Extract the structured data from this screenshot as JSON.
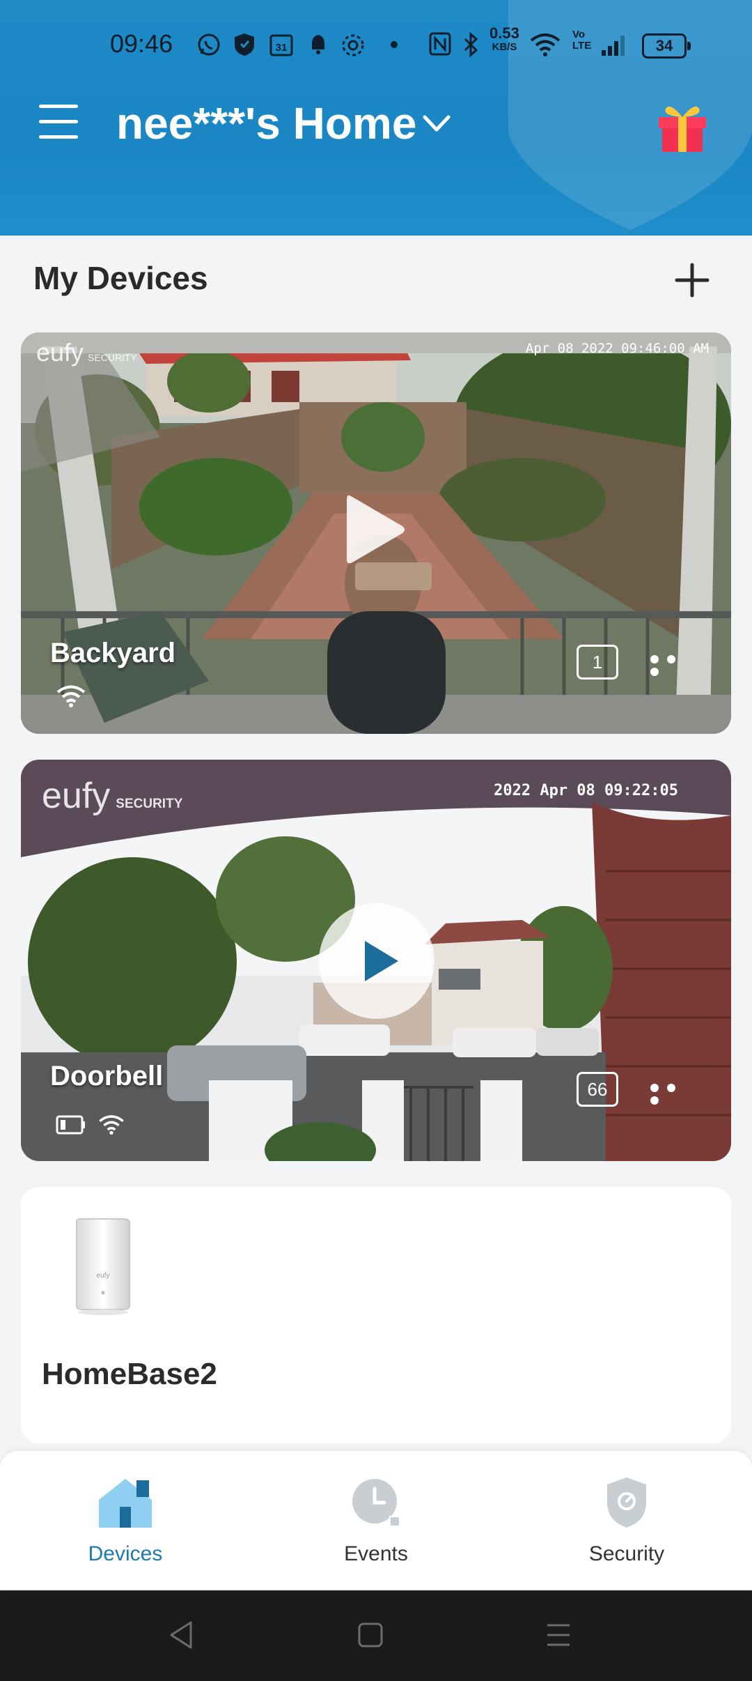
{
  "status_bar": {
    "time": "09:46",
    "net_speed_value": "0.53",
    "net_speed_unit": "KB/S",
    "volte_label": "Vo LTE",
    "calendar_day": "31",
    "battery": "34"
  },
  "header": {
    "home_name": "nee***'s Home",
    "accent_color": "#1e8ac6"
  },
  "section": {
    "title": "My Devices"
  },
  "devices": [
    {
      "name": "Backyard",
      "logo_text": "eufy",
      "logo_sub": "SECURITY",
      "timestamp": "Apr 08 2022  09:46:00 AM",
      "clip_count": "1",
      "icons": [
        "wifi-icon"
      ]
    },
    {
      "name": "Doorbell",
      "logo_text": "eufy",
      "logo_sub": "SECURITY",
      "timestamp": "2022 Apr 08 09:22:05",
      "clip_count": "66",
      "icons": [
        "battery-icon",
        "wifi-icon"
      ]
    }
  ],
  "homebase": {
    "name": "HomeBase2",
    "device_logo": "eufy"
  },
  "bottom_nav": {
    "items": [
      {
        "label": "Devices",
        "icon": "home-icon",
        "active": true
      },
      {
        "label": "Events",
        "icon": "clock-icon",
        "active": false
      },
      {
        "label": "Security",
        "icon": "shield-icon",
        "active": false
      }
    ],
    "active_color": "#1c7ab3"
  }
}
